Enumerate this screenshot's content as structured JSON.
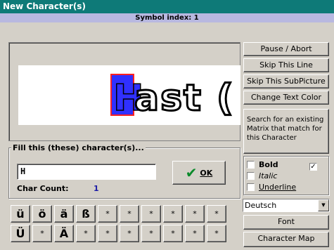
{
  "window": {
    "title": "New Character(s)"
  },
  "header": {
    "symbol_index": "Symbol index: 1"
  },
  "preview": {
    "text": "Hast ("
  },
  "fill_group": {
    "legend": "Fill this (these) character(s)...",
    "input_value": "H",
    "char_count_label": "Char Count:",
    "char_count_value": "1",
    "ok_label": "OK"
  },
  "right_panel": {
    "pause_label": "Pause / Abort",
    "skip_line_label": "Skip This Line",
    "skip_sub_label": "Skip This SubPicture",
    "change_color_label": "Change Text Color",
    "search_label": "Search for an existing Matrix that match for this Character",
    "bold_label": "Bold",
    "italic_label": "Italic",
    "underline_label": "Underline",
    "language_value": "Deutsch",
    "font_label": "Font",
    "charmap_label": "Character Map"
  },
  "keys": {
    "row1": [
      "ü",
      "ö",
      "ä",
      "ß",
      "*",
      "*",
      "*",
      "*",
      "*",
      "*"
    ],
    "row2": [
      "Ü",
      "*",
      "Ä",
      "*",
      "*",
      "*",
      "*",
      "*",
      "*",
      "*"
    ]
  }
}
